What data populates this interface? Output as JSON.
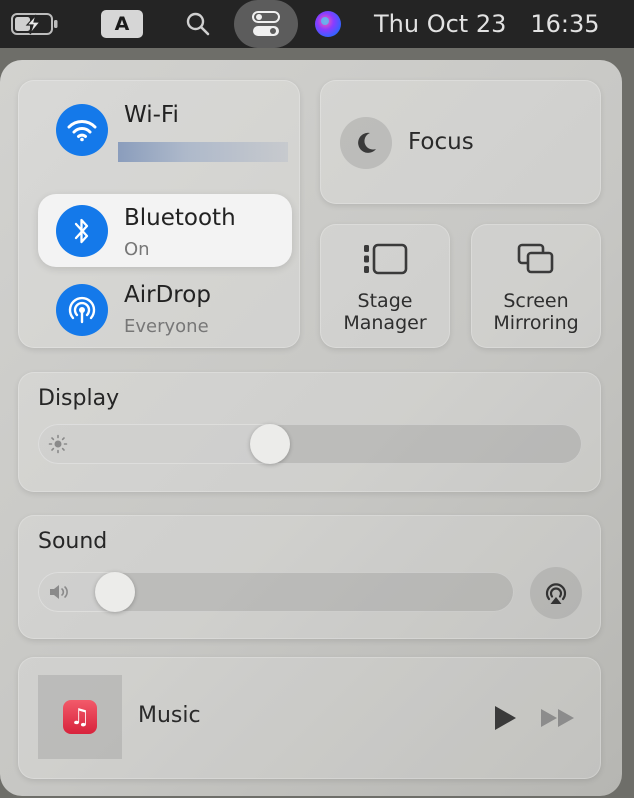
{
  "menubar": {
    "input_source": "A",
    "date": "Thu Oct 23",
    "time": "16:35",
    "icons": [
      "battery-charging-icon",
      "search-icon",
      "control-center-icon",
      "siri-icon"
    ]
  },
  "network": {
    "wifi": {
      "label": "Wi-Fi"
    },
    "bluetooth": {
      "label": "Bluetooth",
      "status": "On"
    },
    "airdrop": {
      "label": "AirDrop",
      "status": "Everyone"
    }
  },
  "focus": {
    "label": "Focus"
  },
  "stage_manager": {
    "label_line1": "Stage",
    "label_line2": "Manager"
  },
  "screen_mirroring": {
    "label_line1": "Screen",
    "label_line2": "Mirroring"
  },
  "display": {
    "title": "Display",
    "brightness_fraction": 0.42
  },
  "sound": {
    "title": "Sound",
    "volume_fraction": 0.13
  },
  "music": {
    "label": "Music"
  },
  "colors": {
    "accent_blue": "#1479ea",
    "menubar": "#242424"
  }
}
